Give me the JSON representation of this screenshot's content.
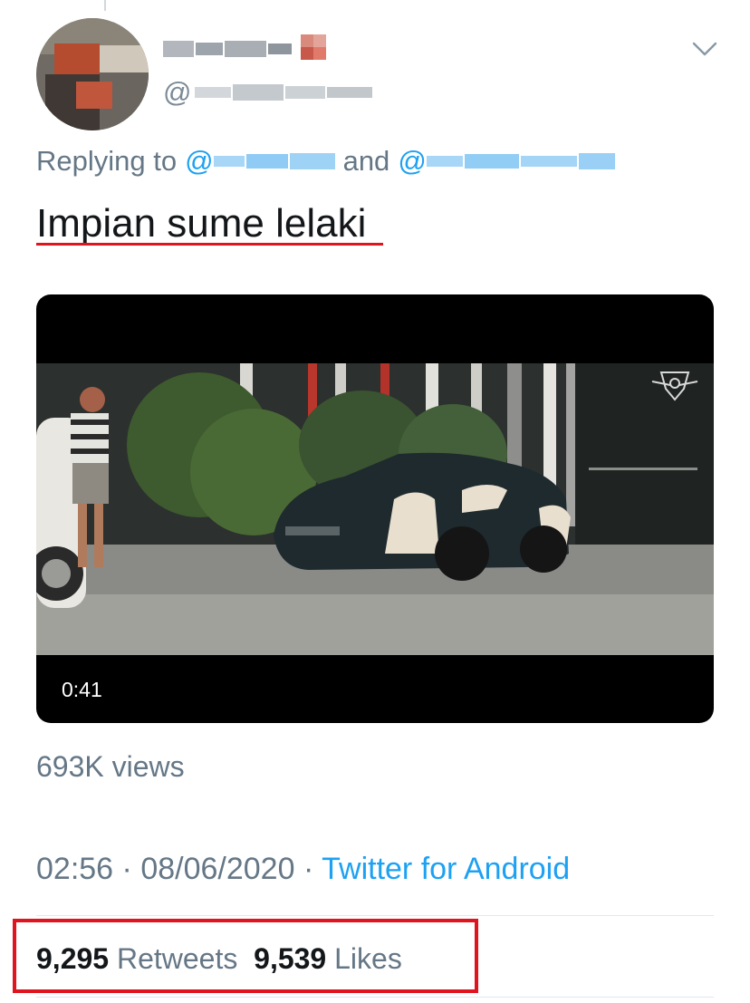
{
  "tweet": {
    "replying_prefix": "Replying to",
    "mention_at_1": "@",
    "conjunction": "and",
    "mention_at_2": "@",
    "handle_at": "@",
    "text": "Impian sume lelaki"
  },
  "video": {
    "duration": "0:41",
    "views": "693K views"
  },
  "meta": {
    "time": "02:56",
    "separator_1": "·",
    "date": "08/06/2020",
    "separator_2": "·",
    "source": "Twitter for Android"
  },
  "stats": {
    "retweets_count": "9,295",
    "retweets_label": "Retweets",
    "likes_count": "9,539",
    "likes_label": "Likes"
  },
  "colors": {
    "link": "#1da1f2",
    "secondary_text": "#657786",
    "primary_text": "#14171a",
    "highlight": "#e0141e"
  },
  "icons": {
    "caret": "chevron-down-icon",
    "watermark": "emblem-watermark-icon"
  }
}
